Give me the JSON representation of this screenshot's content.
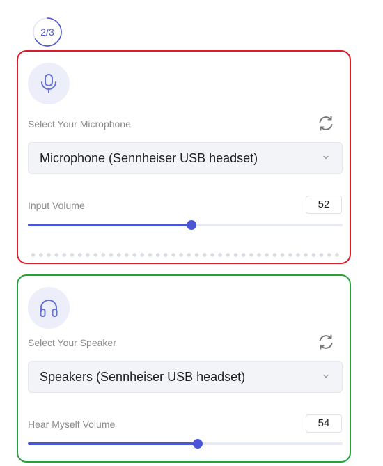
{
  "step": {
    "text": "2/3",
    "progress": 0.667,
    "accent": "#4b55c8"
  },
  "microphone": {
    "border_color": "#e0192b",
    "icon": "microphone-icon",
    "label": "Select Your Microphone",
    "refresh_icon": "refresh-icon",
    "device": "Microphone (Sennheiser USB headset)",
    "volume_label": "Input Volume",
    "volume_value": "52",
    "volume_fraction": 0.52,
    "level_meter_dots": 40
  },
  "speaker": {
    "border_color": "#22a33a",
    "icon": "headphones-icon",
    "label": "Select Your Speaker",
    "refresh_icon": "refresh-icon",
    "device": "Speakers (Sennheiser USB headset)",
    "volume_label": "Hear Myself Volume",
    "volume_value": "54",
    "volume_fraction": 0.54
  },
  "colors": {
    "accent": "#4b55d8",
    "track": "#e8eaf6",
    "icon_bg": "#eceef9"
  }
}
